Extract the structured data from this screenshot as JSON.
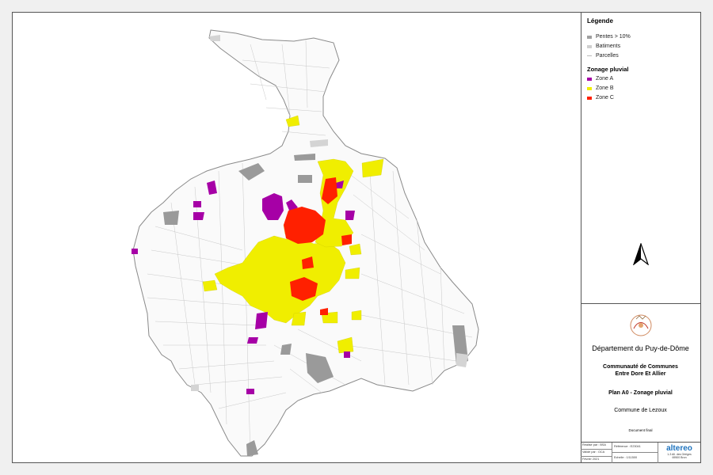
{
  "legend": {
    "title": "Légende",
    "items": [
      {
        "label": "Pentes > 10%",
        "color": "#a0a0a0",
        "kind": "fill"
      },
      {
        "label": "Batiments",
        "color": "#cfcfcf",
        "kind": "fill"
      },
      {
        "label": "Parcelles",
        "color": "#bdbdbd",
        "kind": "line"
      }
    ],
    "zoning_title": "Zonage pluvial",
    "zones": [
      {
        "label": "Zone A",
        "color": "#a500a5"
      },
      {
        "label": "Zone B",
        "color": "#f2f000"
      },
      {
        "label": "Zone C",
        "color": "#ff2000"
      }
    ]
  },
  "cartouche": {
    "department": "Département du Puy-de-Dôme",
    "community_line1": "Communauté de Communes",
    "community_line2": "Entre Dore Et Allier",
    "plan": "Plan A0 - Zonage pluvial",
    "commune": "Commune de Lezoux",
    "status": "Document final",
    "realise_par": "Réalisé par : BSA",
    "valide_par": "Validé par : OCA",
    "date": "Février 2021",
    "reference": "Référence : E23041",
    "echelle": "Echelle : 1/11500",
    "brand_name": "altereo",
    "brand_address_line1": "1-3 All. des Grièges",
    "brand_address_line2": "69500 Bron"
  },
  "map": {
    "north_arrow": "north-arrow-icon",
    "logo": "ville-de-lezoux-logo"
  }
}
